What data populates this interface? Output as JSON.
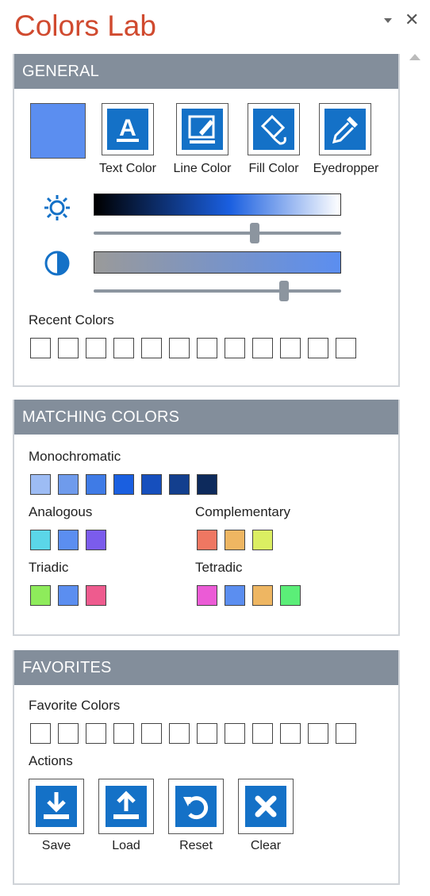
{
  "pane": {
    "title": "Colors Lab",
    "dropdown_icon": "triangle-down-icon",
    "close_glyph": "✕"
  },
  "general": {
    "header": "GENERAL",
    "current_color": "#5b8ef0",
    "tools": [
      {
        "label": "Text Color",
        "icon": "text-color-icon"
      },
      {
        "label": "Line Color",
        "icon": "line-color-icon"
      },
      {
        "label": "Fill Color",
        "icon": "fill-color-icon"
      },
      {
        "label": "Eyedropper",
        "icon": "eyedropper-icon"
      }
    ],
    "brightness_level": 0.65,
    "contrast_level": 0.77,
    "recent_label": "Recent Colors"
  },
  "matching": {
    "header": "MATCHING COLORS",
    "monochromatic_label": "Monochromatic",
    "monochromatic": [
      "#9dbcf4",
      "#6f9bec",
      "#3f7be6",
      "#1a5fe0",
      "#164fbd",
      "#133f8e",
      "#0d2a5c"
    ],
    "analogous_label": "Analogous",
    "analogous": [
      "#5bd6e8",
      "#5b8ef0",
      "#7b5cec"
    ],
    "complementary_label": "Complementary",
    "complementary": [
      "#ee7762",
      "#eeb662",
      "#dbee62"
    ],
    "triadic_label": "Triadic",
    "triadic": [
      "#8eeb5b",
      "#5b8ef0",
      "#ee5b8e"
    ],
    "tetradic_label": "Tetradic",
    "tetradic": [
      "#eb5bd6",
      "#5b8ef0",
      "#eeb662",
      "#5bee78"
    ]
  },
  "favorites": {
    "header": "FAVORITES",
    "favorite_label": "Favorite Colors",
    "actions_label": "Actions",
    "actions": [
      {
        "label": "Save",
        "icon": "save-download-icon"
      },
      {
        "label": "Load",
        "icon": "load-upload-icon"
      },
      {
        "label": "Reset",
        "icon": "reset-icon"
      },
      {
        "label": "Clear",
        "icon": "clear-icon"
      }
    ]
  }
}
